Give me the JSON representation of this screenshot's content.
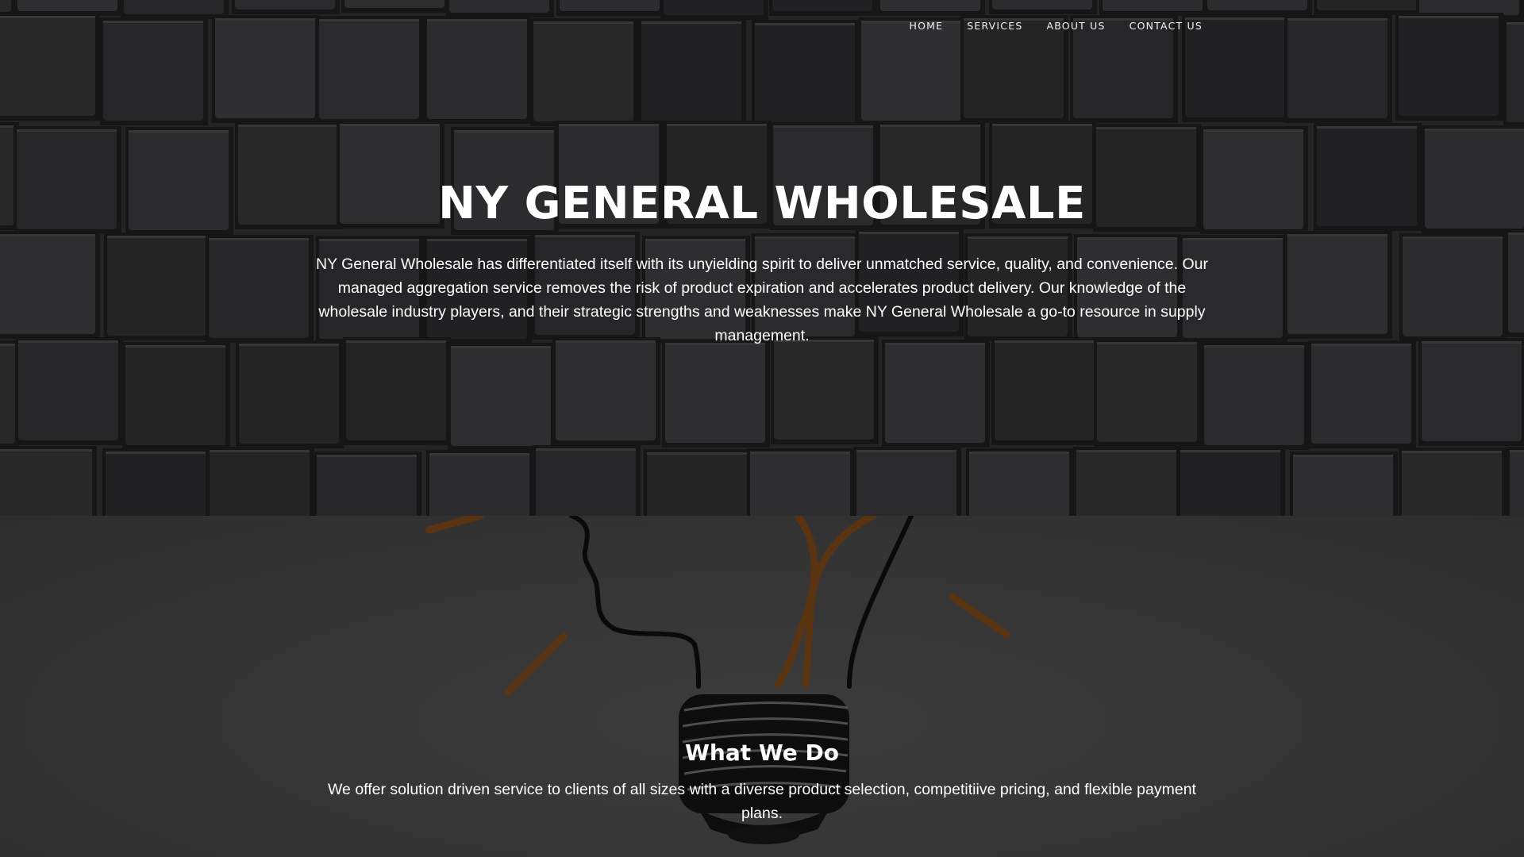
{
  "nav": {
    "items": [
      {
        "label": "HOME"
      },
      {
        "label": "SERVICES"
      },
      {
        "label": "ABOUT US"
      },
      {
        "label": "CONTACT US"
      }
    ]
  },
  "hero": {
    "title": "NY GENERAL WHOLESALE",
    "description": "NY General Wholesale has differentiated itself with its unyielding spirit to deliver unmatched service, quality, and convenience. Our managed aggregation service removes the risk of product expiration and accelerates product delivery. Our knowledge of the wholesale industry players, and their strategic strengths and weaknesses make NY General Wholesale a go-to resource in supply management.",
    "background_image": "dark-cube-wall"
  },
  "what_we_do": {
    "title": "What We Do",
    "description": "We offer solution driven service to clients of all sizes with a diverse product selection, competitiive pricing, and flexible payment plans.",
    "background_image": "light-bulb-sketch",
    "accent_color": "#5a3410"
  },
  "colors": {
    "hero_bg": "#262626",
    "section_bg": "#363636",
    "text": "#ffffff"
  }
}
